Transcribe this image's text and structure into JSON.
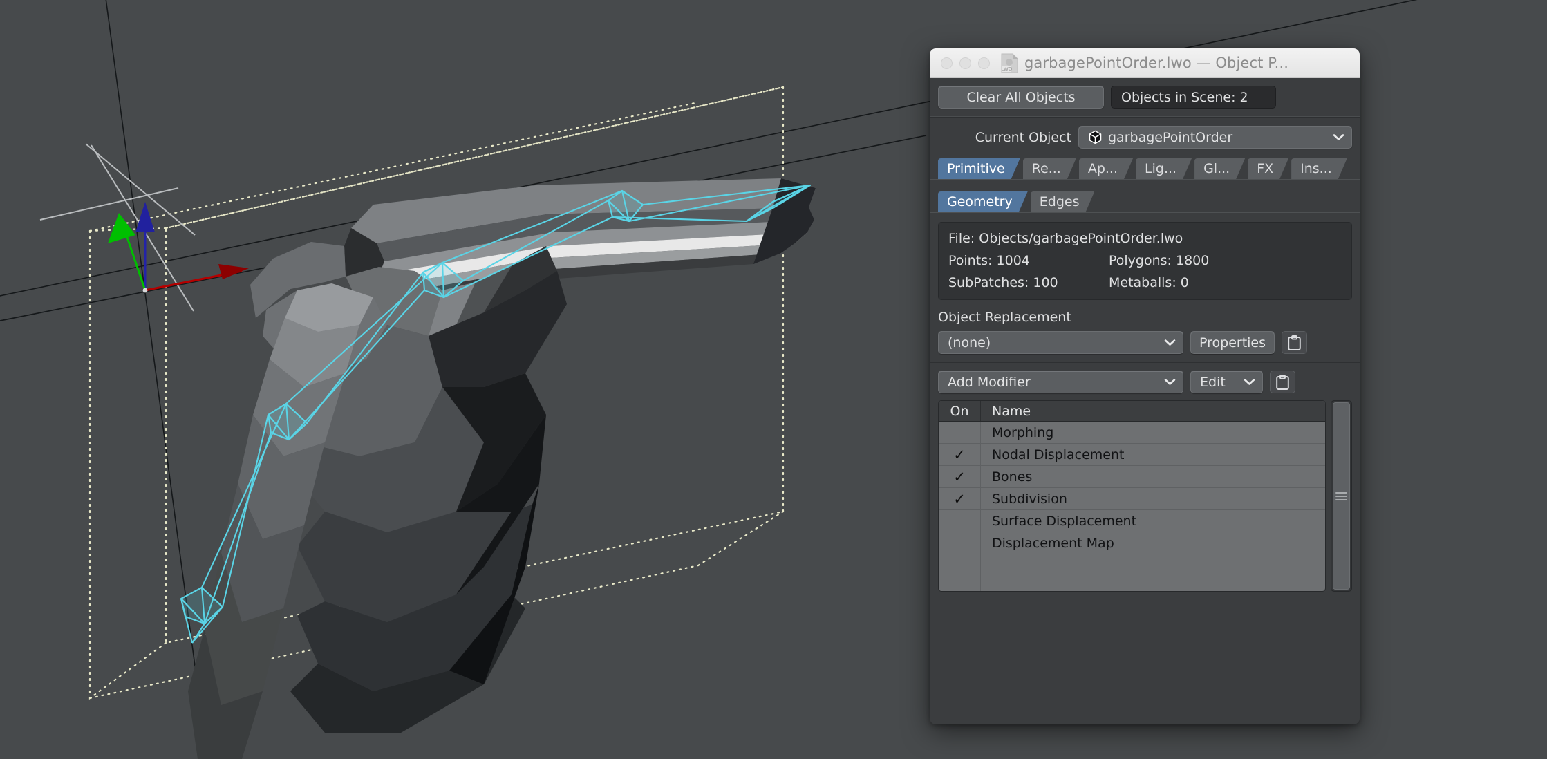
{
  "window": {
    "title": "garbagePointOrder.lwo — Object P...",
    "file_icon": "lwo-file-icon",
    "traffic_lights": [
      "close-button",
      "minimize-button",
      "zoom-button"
    ]
  },
  "toolbar": {
    "clear_all_label": "Clear All Objects",
    "objects_in_scene_label": "Objects in Scene: 2"
  },
  "current_object": {
    "label": "Current Object",
    "value": "garbagePointOrder",
    "icon": "cube-icon"
  },
  "primary_tabs": [
    {
      "label": "Primitive",
      "active": true
    },
    {
      "label": "Re...",
      "active": false
    },
    {
      "label": "Ap...",
      "active": false
    },
    {
      "label": "Lig...",
      "active": false
    },
    {
      "label": "Gl...",
      "active": false
    },
    {
      "label": "FX",
      "active": false
    },
    {
      "label": "Ins...",
      "active": false
    }
  ],
  "secondary_tabs": [
    {
      "label": "Geometry",
      "active": true
    },
    {
      "label": "Edges",
      "active": false
    }
  ],
  "geometry_info": {
    "file": "File: Objects/garbagePointOrder.lwo",
    "points": "Points: 1004",
    "polygons": "Polygons: 1800",
    "subpatches": "SubPatches: 100",
    "metaballs": "Metaballs: 0"
  },
  "object_replacement": {
    "section_label": "Object Replacement",
    "value": "(none)",
    "properties_label": "Properties",
    "clipboard_icon": "clipboard-icon"
  },
  "modifier_controls": {
    "add_label": "Add Modifier",
    "edit_label": "Edit",
    "clipboard_icon": "clipboard-icon"
  },
  "modifier_list": {
    "columns": [
      "On",
      "Name"
    ],
    "check_glyph": "✓",
    "rows": [
      {
        "on": false,
        "name": "Morphing"
      },
      {
        "on": true,
        "name": "Nodal Displacement"
      },
      {
        "on": true,
        "name": "Bones"
      },
      {
        "on": true,
        "name": "Subdivision"
      },
      {
        "on": false,
        "name": "Surface Displacement"
      },
      {
        "on": false,
        "name": "Displacement Map"
      }
    ]
  },
  "viewport": {
    "name": "3d-perspective-viewport",
    "background": "#474a4c",
    "axis_gizmo": {
      "x_color": "#b50000",
      "y_color": "#00c000",
      "z_color": "#2020b0"
    },
    "selection_color": "#5ad4e6",
    "bounding_box_color": "#e8e8c8"
  },
  "colors": {
    "accent": "#52769e",
    "panel_bg": "#3b3d3f",
    "button_bg": "#5b5e61",
    "list_bg": "#6e7072",
    "titlebar_bg": "#eeeeee"
  }
}
